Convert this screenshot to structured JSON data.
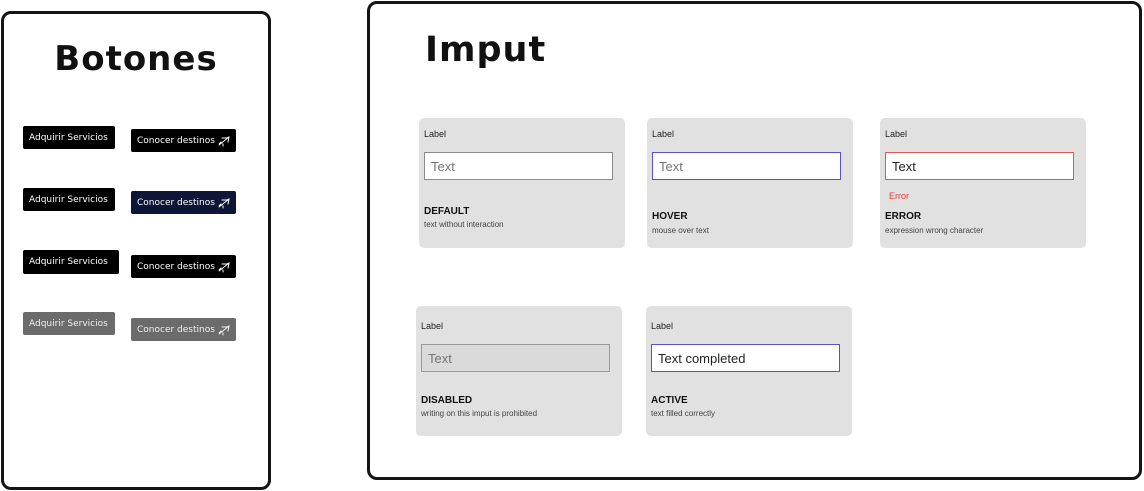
{
  "buttons_panel": {
    "title": "Botones",
    "rows": [
      {
        "primary_label": "Adquirir Servicios",
        "secondary_label": "Conocer destinos"
      },
      {
        "primary_label": "Adquirir Servicios",
        "secondary_label": "Conocer destinos"
      },
      {
        "primary_label": "Adquirir Servicios",
        "secondary_label": "Conocer destinos"
      },
      {
        "primary_label": "Adquirir Servicios",
        "secondary_label": "Conocer destinos"
      }
    ],
    "secondary_icon": "airplane-icon",
    "colors": {
      "primary": "#000000",
      "hover": "#0d1636",
      "disabled": "#6b6b6b"
    }
  },
  "input_panel": {
    "title": "Imput",
    "cards": [
      {
        "label": "Label",
        "value": "",
        "placeholder": "Text",
        "state": "DEFAULT",
        "description": "text without interaction"
      },
      {
        "label": "Label",
        "value": "",
        "placeholder": "Text",
        "state": "HOVER",
        "description": "mouse over text"
      },
      {
        "label": "Label",
        "value": "Text",
        "placeholder": "",
        "error": "Error",
        "state": "ERROR",
        "description": "expression wrong character"
      },
      {
        "label": "Label",
        "value": "",
        "placeholder": "Text",
        "state": "DISABLED",
        "description": "writing on this imput is prohibited"
      },
      {
        "label": "Label",
        "value": "Text completed",
        "placeholder": "",
        "state": "ACTIVE",
        "description": "text filled correctly"
      }
    ],
    "colors": {
      "hover_border": "#5b4fd6",
      "error": "#e85454",
      "card_bg": "#e1e1e1"
    }
  }
}
